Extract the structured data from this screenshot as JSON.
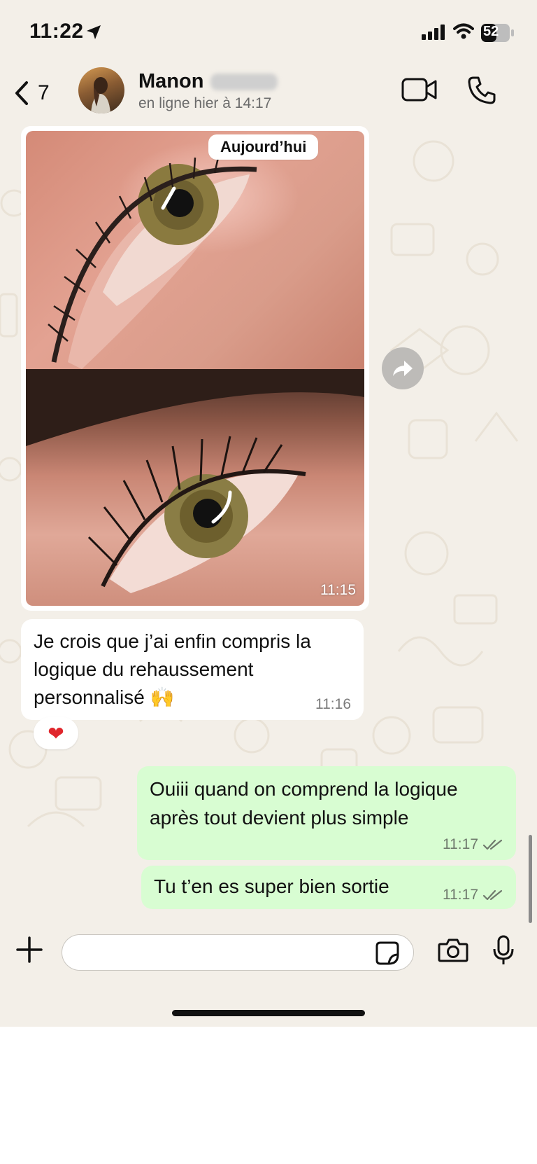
{
  "status_bar": {
    "time": "11:22",
    "battery": "52"
  },
  "header": {
    "back_count": "7",
    "contact_name": "Manon",
    "contact_status": "en ligne hier à 14:17"
  },
  "date_chip": "Aujourd’hui",
  "messages": {
    "photo_time": "11:15",
    "incoming_text": "Je crois que j’ai enfin compris la logique du rehaussement personnalisé 🙌",
    "incoming_time": "11:16",
    "reaction": "❤",
    "outgoing_1_text": "Ouiii quand on comprend la logique après tout devient plus simple",
    "outgoing_1_time": "11:17",
    "outgoing_2_text": "Tu t’en es super bien sortie",
    "outgoing_2_time": "11:17"
  },
  "composer": {
    "value": "",
    "placeholder": ""
  },
  "icons": {
    "back": "chevron-left-icon",
    "video": "video-camera-icon",
    "call": "phone-icon",
    "forward": "forward-arrow-icon",
    "plus": "plus-icon",
    "sticker": "sticker-icon",
    "camera": "camera-icon",
    "mic": "microphone-icon"
  },
  "colors": {
    "chat_background": "#f3efe8",
    "outgoing_bubble": "#d8fdd2",
    "incoming_bubble": "#ffffff",
    "read_ticks": "#6f7a6d"
  }
}
